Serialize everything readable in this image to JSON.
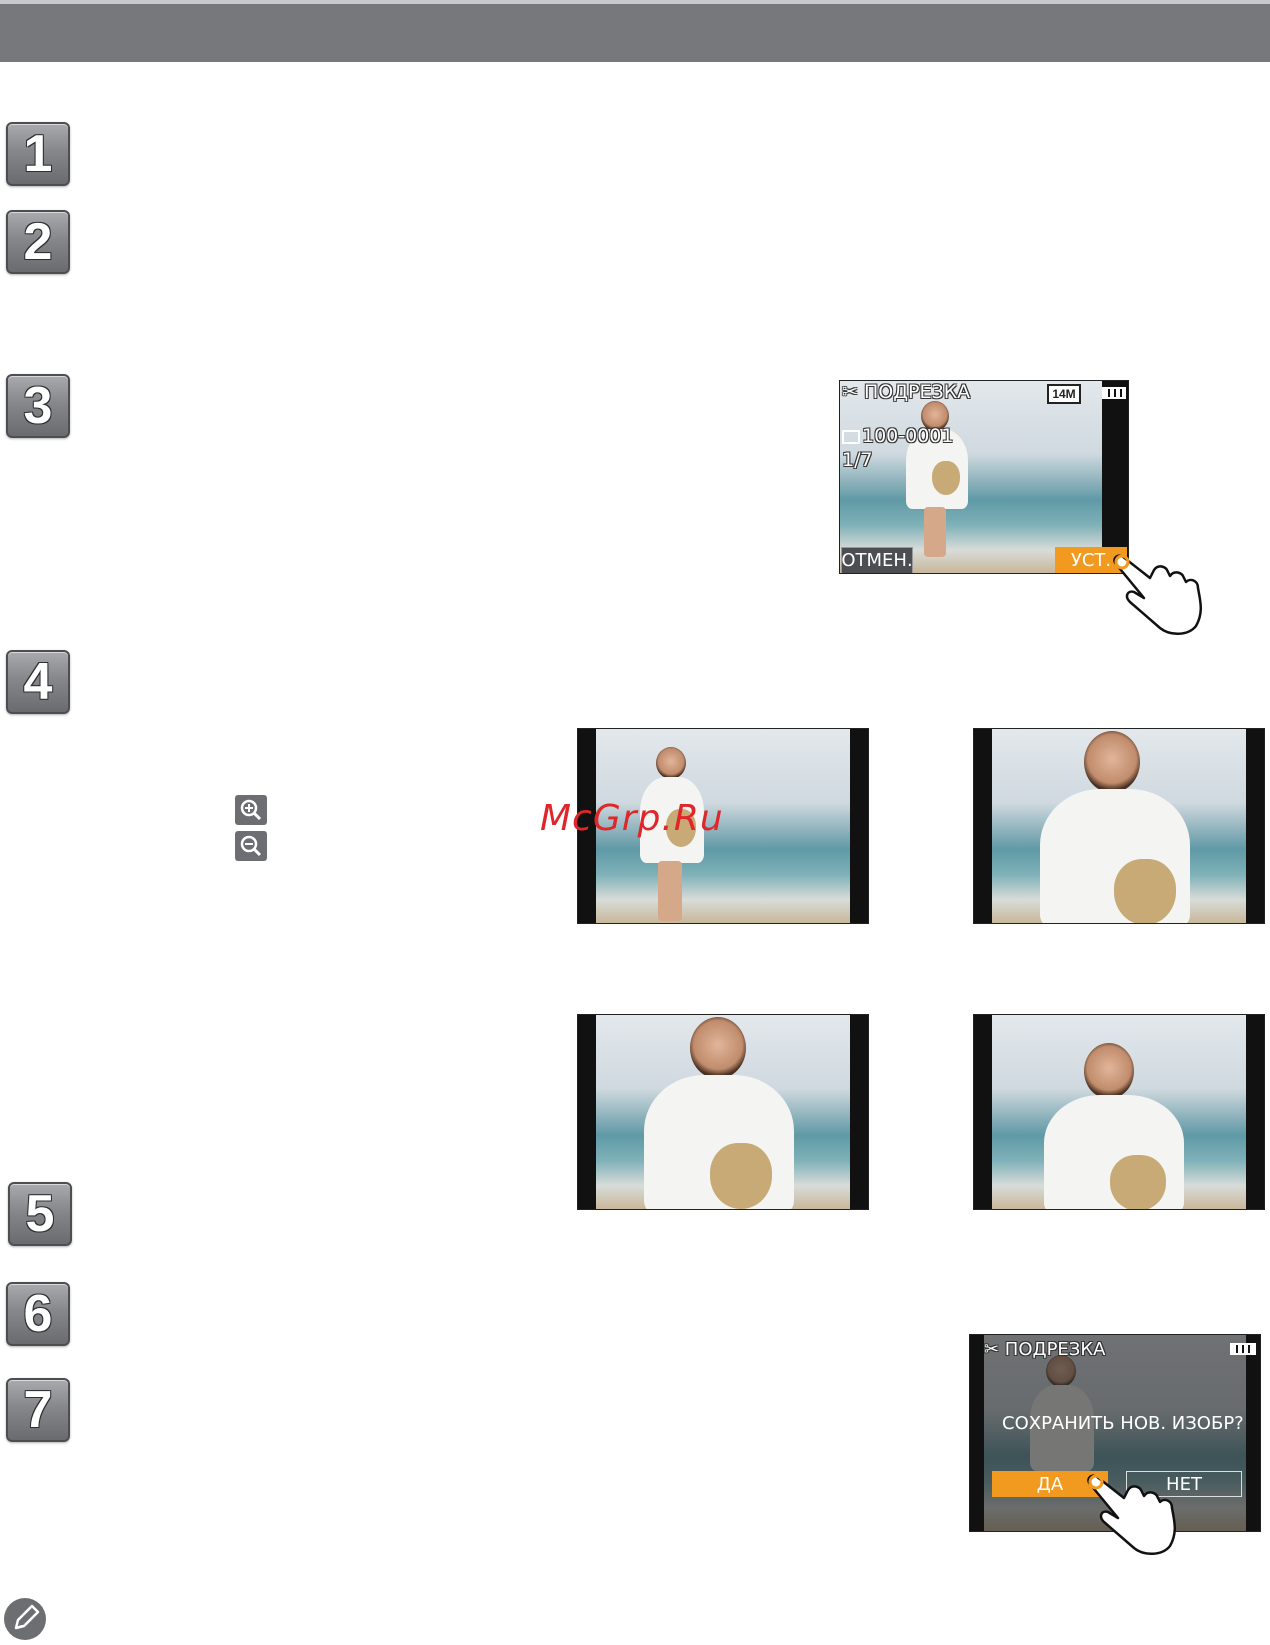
{
  "steps": [
    "1",
    "2",
    "3",
    "4",
    "5",
    "6",
    "7"
  ],
  "screen_crop_select": {
    "mode_label": "✂ ПОДРЕЗКА",
    "size_badge": "14M",
    "file_number": "100-0001",
    "frame_counter": "1/7",
    "cancel_label": "ОТМЕН.",
    "set_label": "УСТ."
  },
  "zoom_icons": [
    "zoom-in-icon",
    "zoom-out-icon"
  ],
  "watermark": "McGrp.Ru",
  "screen_save": {
    "mode_label": "✂ ПОДРЕЗКА",
    "question": "СОХРАНИТЬ НОВ. ИЗОБР?",
    "yes_label": "ДА",
    "no_label": "НЕТ"
  },
  "colors": {
    "header": "#77787c",
    "accent_orange": "#f29a1f",
    "badge_gray": "#86878b"
  }
}
